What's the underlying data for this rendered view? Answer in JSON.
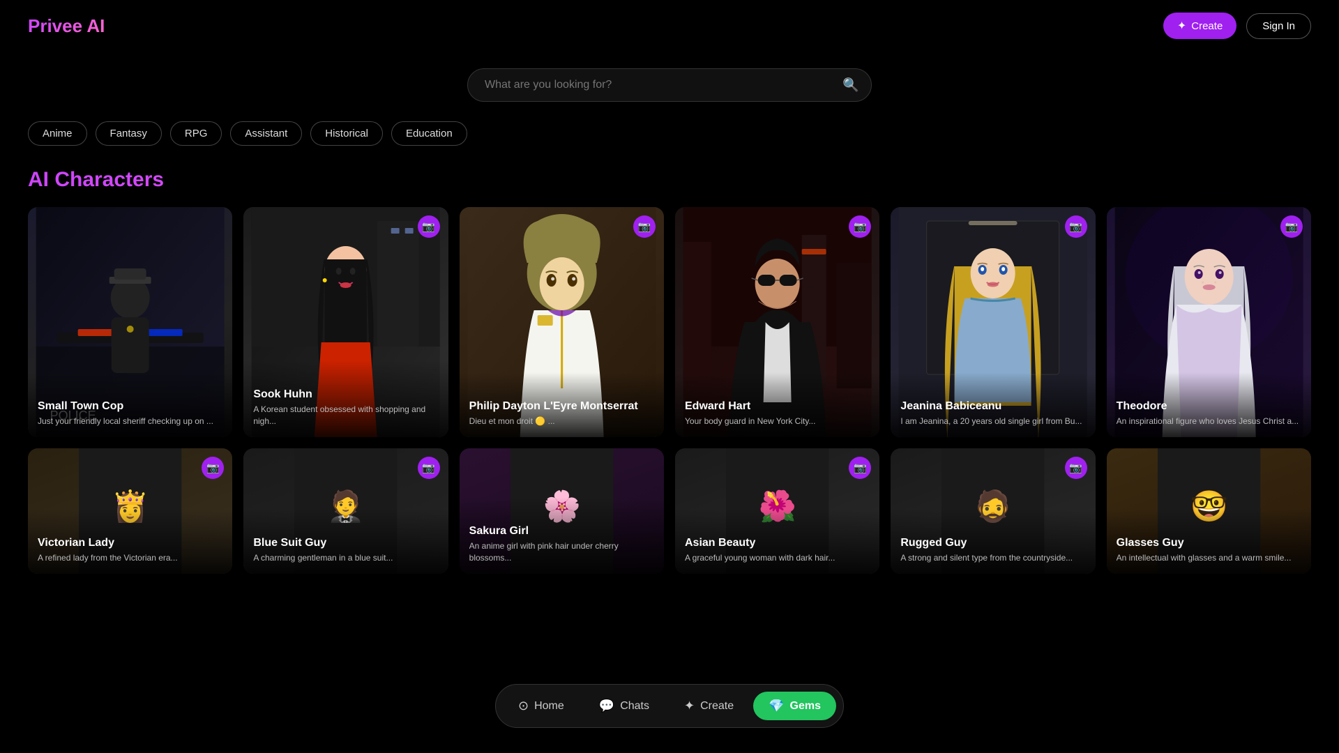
{
  "header": {
    "logo": "Privee AI",
    "create_label": "Create",
    "signin_label": "Sign In"
  },
  "search": {
    "placeholder": "What are you looking for?"
  },
  "filters": [
    "Anime",
    "Fantasy",
    "RPG",
    "Assistant",
    "Historical",
    "Education"
  ],
  "section": {
    "title": "AI Characters"
  },
  "characters_row1": [
    {
      "name": "Small Town Cop",
      "desc": "Just your friendly local sheriff checking up on ...",
      "bg": "bg-cop",
      "emoji": "🚔",
      "has_camera": false
    },
    {
      "name": "Sook Huhn",
      "desc": "A Korean student obsessed with shopping and nigh...",
      "bg": "bg-sook",
      "emoji": "👩",
      "has_camera": true
    },
    {
      "name": "Philip Dayton L'Eyre Montserrat",
      "desc": "Dieu et mon droit 🟡 ...",
      "bg": "bg-philip",
      "emoji": "🧑‍🎨",
      "has_camera": true
    },
    {
      "name": "Edward Hart",
      "desc": "Your body guard in New York City...",
      "bg": "bg-edward",
      "emoji": "🕶️",
      "has_camera": true
    },
    {
      "name": "Jeanina Babiceanu",
      "desc": "I am Jeanina, a 20 years old single girl from Bu...",
      "bg": "bg-jeanina",
      "emoji": "👱‍♀️",
      "has_camera": true
    },
    {
      "name": "Theodore",
      "desc": "An inspirational figure who loves Jesus Christ a...",
      "bg": "bg-theodore",
      "emoji": "🧝",
      "has_camera": true
    }
  ],
  "characters_row2": [
    {
      "name": "Victorian Lady",
      "desc": "A refined lady from the Victorian era...",
      "bg": "bg-row2-1",
      "emoji": "👸",
      "has_camera": true
    },
    {
      "name": "Blue Suit Guy",
      "desc": "A charming gentleman in a blue suit...",
      "bg": "bg-row2-2",
      "emoji": "🤵",
      "has_camera": true
    },
    {
      "name": "Sakura Girl",
      "desc": "An anime girl with pink hair under cherry blossoms...",
      "bg": "bg-row2-3",
      "emoji": "🌸",
      "has_camera": false
    },
    {
      "name": "Asian Beauty",
      "desc": "A graceful young woman with dark hair...",
      "bg": "bg-row2-4",
      "emoji": "🌺",
      "has_camera": true
    },
    {
      "name": "Rugged Guy",
      "desc": "A strong and silent type from the countryside...",
      "bg": "bg-row2-5",
      "emoji": "🧔",
      "has_camera": true
    },
    {
      "name": "Glasses Guy",
      "desc": "An intellectual with glasses and a warm smile...",
      "bg": "bg-row2-6",
      "emoji": "🤓",
      "has_camera": false
    }
  ],
  "bottom_nav": [
    {
      "icon": "⊙",
      "label": "Home",
      "active": false
    },
    {
      "icon": "💬",
      "label": "Chats",
      "active": false
    },
    {
      "icon": "✦",
      "label": "Create",
      "active": false
    },
    {
      "icon": "💎",
      "label": "Gems",
      "active": true
    }
  ]
}
